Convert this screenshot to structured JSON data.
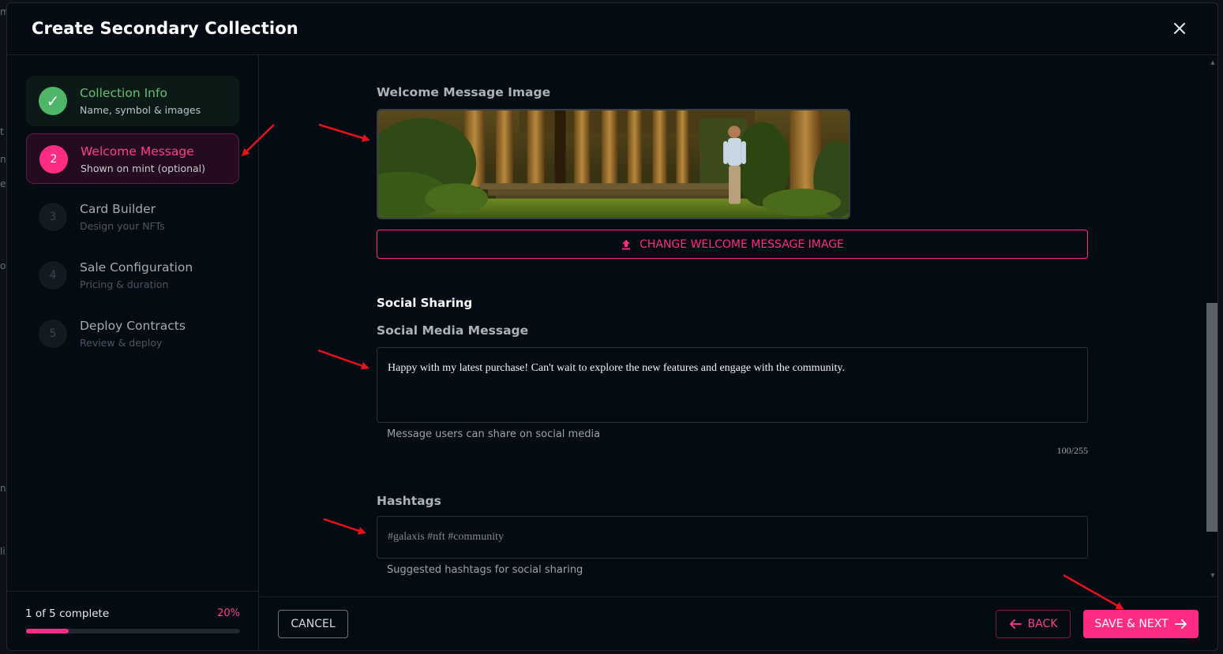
{
  "modal": {
    "title": "Create Secondary Collection"
  },
  "steps": [
    {
      "number": "✓",
      "title": "Collection Info",
      "subtitle": "Name, symbol & images",
      "state": "done"
    },
    {
      "number": "2",
      "title": "Welcome Message",
      "subtitle": "Shown on mint (optional)",
      "state": "active"
    },
    {
      "number": "3",
      "title": "Card Builder",
      "subtitle": "Design your NFTs",
      "state": "pending"
    },
    {
      "number": "4",
      "title": "Sale Configuration",
      "subtitle": "Pricing & duration",
      "state": "pending"
    },
    {
      "number": "5",
      "title": "Deploy Contracts",
      "subtitle": "Review & deploy",
      "state": "pending"
    }
  ],
  "progress": {
    "text": "1 of 5 complete",
    "percent_label": "20%",
    "fraction": 0.2
  },
  "welcome": {
    "label": "Welcome Message Image",
    "change_button": "CHANGE WELCOME MESSAGE IMAGE"
  },
  "social": {
    "heading": "Social Sharing",
    "message_label": "Social Media Message",
    "message_value": "Happy with my latest purchase! Can't wait to explore the new features and engage with the community.",
    "message_helper": "Message users can share on social media",
    "counter": "100/255",
    "hashtags_label": "Hashtags",
    "hashtags_placeholder": "#galaxis #nft #community",
    "hashtags_helper": "Suggested hashtags for social sharing"
  },
  "footer": {
    "cancel": "CANCEL",
    "back": "BACK",
    "next": "SAVE & NEXT"
  },
  "colors": {
    "accent": "#ff2c83",
    "success": "#4fb669",
    "background": "#040b12",
    "annotation_arrow": "#e8121b"
  }
}
